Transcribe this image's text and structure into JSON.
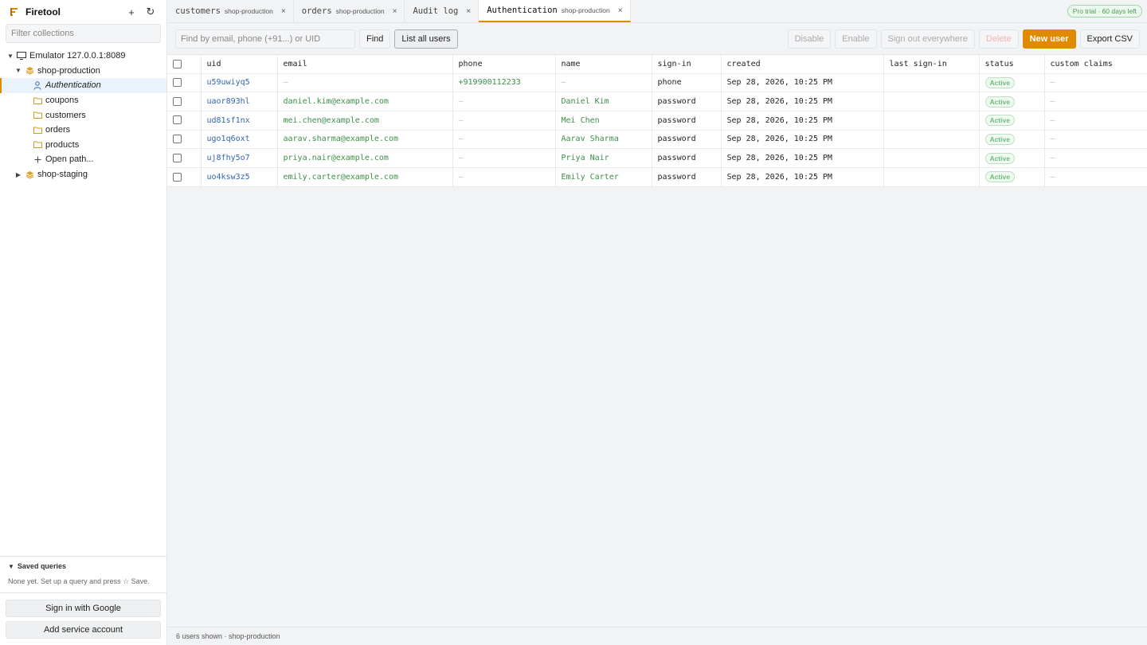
{
  "app": {
    "title": "Firetool",
    "add_icon_glyph": "+",
    "refresh_icon_glyph": "↻",
    "accent_color": "#e08a00"
  },
  "sidebar": {
    "filter_placeholder": "Filter collections",
    "emulator_label": "Emulator 127.0.0.1:8089",
    "projects": [
      {
        "name": "shop-production",
        "expanded": true,
        "items": [
          {
            "label": "Authentication",
            "icon": "user-icon",
            "active": true
          },
          {
            "label": "coupons",
            "icon": "folder-icon"
          },
          {
            "label": "customers",
            "icon": "folder-icon"
          },
          {
            "label": "orders",
            "icon": "folder-icon"
          },
          {
            "label": "products",
            "icon": "folder-icon"
          },
          {
            "label": "Open path...",
            "icon": "plus-icon"
          }
        ]
      },
      {
        "name": "shop-staging",
        "expanded": false
      }
    ],
    "saved_queries": {
      "title": "Saved queries",
      "empty_text": "None yet. Set up a query and press ☆ Save."
    },
    "sign_in_label": "Sign in with Google",
    "add_account_label": "Add service account"
  },
  "tabs": [
    {
      "name": "customers",
      "sub": "shop-production",
      "active": false
    },
    {
      "name": "orders",
      "sub": "shop-production",
      "active": false
    },
    {
      "name": "Audit log",
      "sub": "",
      "active": false
    },
    {
      "name": "Authentication",
      "sub": "shop-production",
      "active": true
    }
  ],
  "tab_close_glyph": "×",
  "trial_badge": "Pro trial · 60 days left",
  "toolbar": {
    "search_placeholder": "Find by email, phone (+91...) or UID",
    "find_label": "Find",
    "list_all_label": "List all users",
    "disable_label": "Disable",
    "enable_label": "Enable",
    "sign_out_label": "Sign out everywhere",
    "delete_label": "Delete",
    "new_user_label": "New user",
    "export_label": "Export CSV"
  },
  "table": {
    "columns": [
      "uid",
      "email",
      "phone",
      "name",
      "sign-in",
      "created",
      "last sign-in",
      "status",
      "custom claims"
    ],
    "rows": [
      {
        "uid": "u59uwiyq5",
        "email": "—",
        "phone": "+919900112233",
        "name": "—",
        "signin": "phone",
        "created": "Sep 28, 2026, 10:25 PM",
        "last": "",
        "status": "Active",
        "claims": "—"
      },
      {
        "uid": "uaor893hl",
        "email": "daniel.kim@example.com",
        "phone": "—",
        "name": "Daniel Kim",
        "signin": "password",
        "created": "Sep 28, 2026, 10:25 PM",
        "last": "",
        "status": "Active",
        "claims": "—"
      },
      {
        "uid": "ud81sf1nx",
        "email": "mei.chen@example.com",
        "phone": "—",
        "name": "Mei Chen",
        "signin": "password",
        "created": "Sep 28, 2026, 10:25 PM",
        "last": "",
        "status": "Active",
        "claims": "—"
      },
      {
        "uid": "ugo1q6oxt",
        "email": "aarav.sharma@example.com",
        "phone": "—",
        "name": "Aarav Sharma",
        "signin": "password",
        "created": "Sep 28, 2026, 10:25 PM",
        "last": "",
        "status": "Active",
        "claims": "—"
      },
      {
        "uid": "uj8fhy5o7",
        "email": "priya.nair@example.com",
        "phone": "—",
        "name": "Priya Nair",
        "signin": "password",
        "created": "Sep 28, 2026, 10:25 PM",
        "last": "",
        "status": "Active",
        "claims": "—"
      },
      {
        "uid": "uo4ksw3z5",
        "email": "emily.carter@example.com",
        "phone": "—",
        "name": "Emily Carter",
        "signin": "password",
        "created": "Sep 28, 2026, 10:25 PM",
        "last": "",
        "status": "Active",
        "claims": "—"
      }
    ]
  },
  "footer_text": "6 users shown · shop-production"
}
